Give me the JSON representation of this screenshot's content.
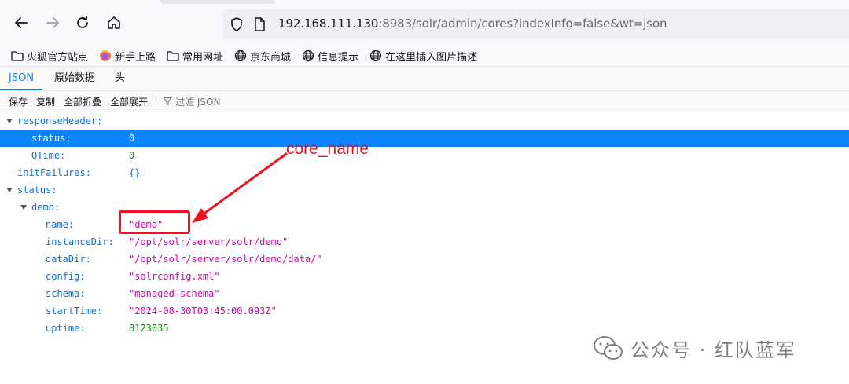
{
  "browser": {
    "url_host": "192.168.111.130",
    "url_rest": ":8983/solr/admin/cores?indexInfo=false&wt=json"
  },
  "bookmarks": [
    {
      "label": "火狐官方站点",
      "icon": "folder-icon"
    },
    {
      "label": "新手上路",
      "icon": "firefox-icon"
    },
    {
      "label": "常用网址",
      "icon": "folder-icon"
    },
    {
      "label": "京东商城",
      "icon": "globe-icon"
    },
    {
      "label": "信息提示",
      "icon": "globe-icon"
    },
    {
      "label": "在这里插入图片描述",
      "icon": "globe-icon"
    }
  ],
  "viewer_tabs": {
    "json": "JSON",
    "raw": "原始数据",
    "headers": "头"
  },
  "toolbar": {
    "save": "保存",
    "copy": "复制",
    "collapse_all": "全部折叠",
    "expand_all": "全部展开",
    "filter_placeholder": "过滤 JSON"
  },
  "json_tree": {
    "responseHeader_key": "responseHeader:",
    "status_key": "status:",
    "status_val": "0",
    "qtime_key": "QTime:",
    "qtime_val": "0",
    "initFailures_key": "initFailures:",
    "initFailures_val": "{}",
    "status2_key": "status:",
    "demo_key": "demo:",
    "fields": [
      {
        "key": "name:",
        "value": "\"demo\"",
        "type": "str"
      },
      {
        "key": "instanceDir:",
        "value": "\"/opt/solr/server/solr/demo\"",
        "type": "str"
      },
      {
        "key": "dataDir:",
        "value": "\"/opt/solr/server/solr/demo/data/\"",
        "type": "str"
      },
      {
        "key": "config:",
        "value": "\"solrconfig.xml\"",
        "type": "str"
      },
      {
        "key": "schema:",
        "value": "\"managed-schema\"",
        "type": "str"
      },
      {
        "key": "startTime:",
        "value": "\"2024-08-30T03:45:00.093Z\"",
        "type": "str"
      },
      {
        "key": "uptime:",
        "value": "8123035",
        "type": "num"
      }
    ]
  },
  "annotation": {
    "label": "core_name",
    "color": "#ee1122"
  },
  "watermark": {
    "text": "公众号 · 红队蓝军"
  },
  "colors": {
    "accent": "#0a84ff",
    "key": "#0074e8",
    "string": "#dd00a9",
    "number": "#058b00"
  }
}
